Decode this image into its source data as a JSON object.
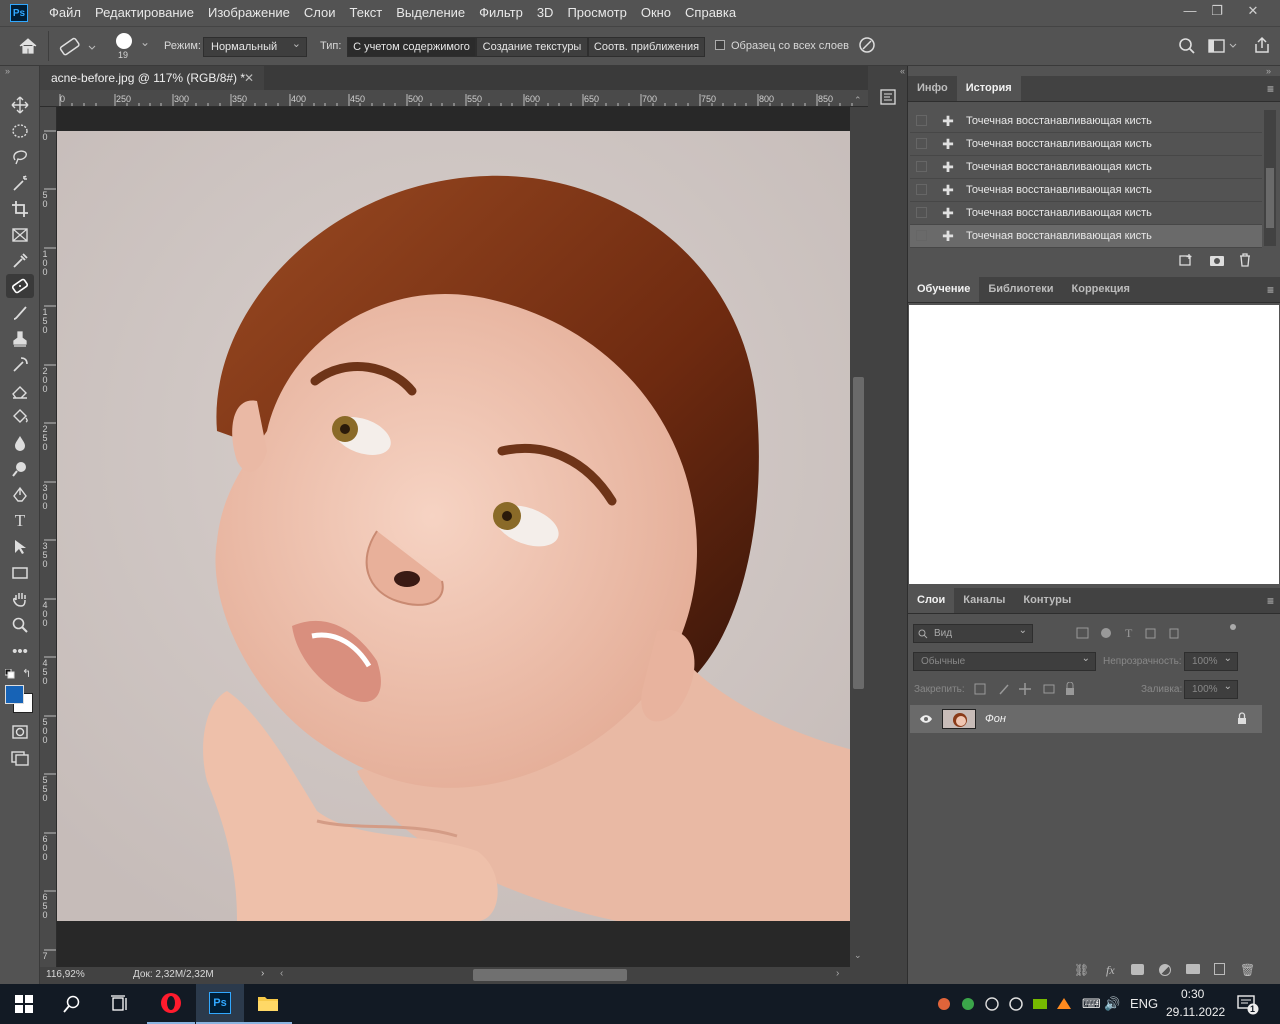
{
  "menu": {
    "items": [
      "Файл",
      "Редактирование",
      "Изображение",
      "Слои",
      "Текст",
      "Выделение",
      "Фильтр",
      "3D",
      "Просмотр",
      "Окно",
      "Справка"
    ],
    "logo": "Ps",
    "window_controls": [
      "—",
      "❐",
      "✕"
    ]
  },
  "options": {
    "brush_size": "19",
    "mode_label": "Режим:",
    "mode_value": "Нормальный",
    "type_label": "Тип:",
    "type_options": [
      "С учетом содержимого",
      "Создание текстуры",
      "Соотв. приближения"
    ],
    "sample_all_label": "Образец со всех слоев"
  },
  "document": {
    "tab_title": "acne-before.jpg @ 117% (RGB/8#) *",
    "zoom": "116,92%",
    "doc_size": "Док: 2,32M/2,32M",
    "ruler_top_labels": [
      "0",
      "250",
      "300",
      "350",
      "400",
      "450",
      "500",
      "550",
      "600",
      "650",
      "700",
      "750",
      "800",
      "850"
    ],
    "ruler_left_labels": [
      "0",
      "5 0",
      "1 0 0",
      "1 5 0",
      "2 0 0",
      "2 5 0",
      "3 0 0",
      "3 5 0",
      "4 0 0",
      "4 5 0",
      "5 0 0",
      "5 5 0",
      "6 0 0",
      "6 5 0",
      "7"
    ]
  },
  "history_panel": {
    "tabs": [
      "Инфо",
      "История"
    ],
    "rows": [
      "Точечная восстанавливающая кисть",
      "Точечная восстанавливающая кисть",
      "Точечная восстанавливающая кисть",
      "Точечная восстанавливающая кисть",
      "Точечная восстанавливающая кисть",
      "Точечная восстанавливающая кисть"
    ]
  },
  "learn_panel": {
    "tabs": [
      "Обучение",
      "Библиотеки",
      "Коррекция"
    ]
  },
  "layers_panel": {
    "tabs": [
      "Слои",
      "Каналы",
      "Контуры"
    ],
    "filter_placeholder": "Вид",
    "blend_mode": "Обычные",
    "opacity_label": "Непрозрачность:",
    "opacity_value": "100%",
    "lock_label": "Закрепить:",
    "fill_label": "Заливка:",
    "fill_value": "100%",
    "layer_name": "Фон"
  },
  "taskbar": {
    "lang": "ENG",
    "time": "0:30",
    "date": "29.11.2022",
    "notifications": "1"
  },
  "colors": {
    "foreground": "#1763b6",
    "background": "#ffffff",
    "photo_bg": "#cfc6c3",
    "hair": "#7a3516",
    "skin": "#efc6b2"
  }
}
